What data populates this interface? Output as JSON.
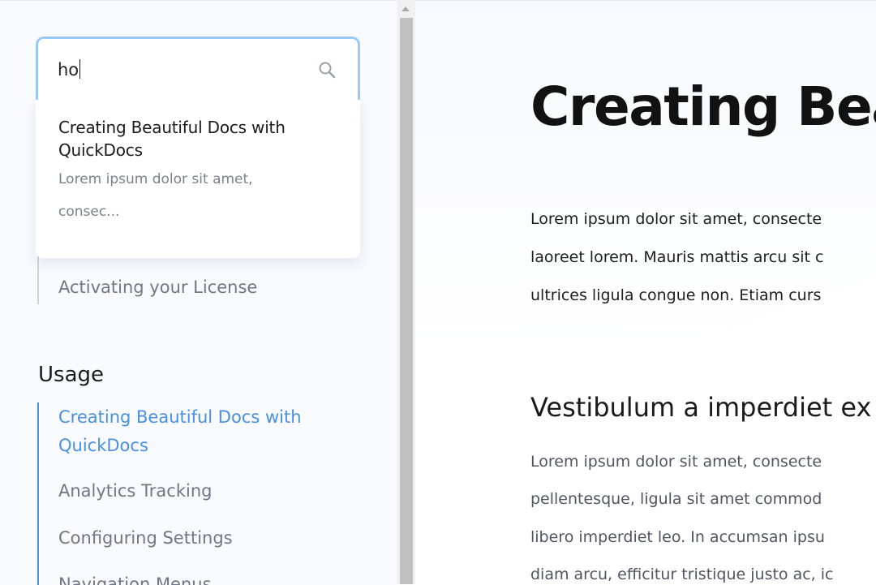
{
  "search": {
    "value": "ho",
    "icon": "search-icon",
    "results": [
      {
        "title_line1": "Creating Beautiful Docs with",
        "title_line2": "QuickDocs",
        "snippet_line1": "Lorem ipsum dolor sit amet,",
        "snippet_line2": "consec..."
      }
    ]
  },
  "sidebar": {
    "items_before": [
      {
        "label": "Activating your License"
      }
    ],
    "section": {
      "title": "Usage",
      "items": [
        {
          "label_line1": "Creating Beautiful Docs with",
          "label_line2": "QuickDocs",
          "active": true
        },
        {
          "label": "Analytics Tracking"
        },
        {
          "label": "Configuring Settings"
        },
        {
          "label": "Navigation Menus"
        }
      ]
    }
  },
  "main": {
    "title": "Creating Bea",
    "intro": [
      "Lorem ipsum dolor sit amet, consecte",
      "laoreet lorem. Mauris mattis arcu sit c",
      "ultrices ligula congue non. Etiam curs"
    ],
    "section_heading": "Vestibulum a imperdiet ex",
    "section_paragraph": [
      "Lorem ipsum dolor sit amet, consecte",
      "pellentesque, ligula sit amet commod",
      "libero imperdiet leo. In accumsan ipsu",
      "diam arcu, efficitur tristique justo ac, ic"
    ]
  },
  "colors": {
    "accent": "#4a90e2",
    "search_border": "#9cc9f3",
    "sidebar_bg": "#f8fafd"
  }
}
